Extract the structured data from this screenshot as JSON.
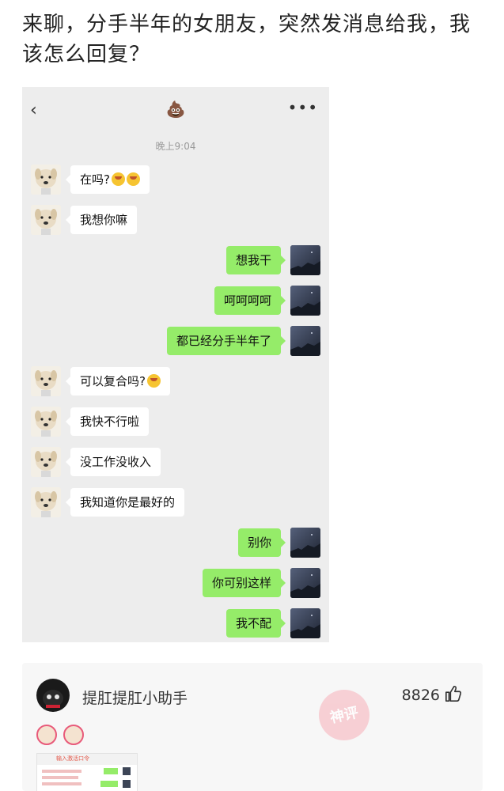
{
  "post": {
    "title": "来聊，分手半年的女朋友，突然发消息给我，我该怎么回复？"
  },
  "chat": {
    "contact_name": "💩",
    "timestamp": "晚上9:04",
    "messages": [
      {
        "side": "left",
        "text": "在吗?",
        "emoji_count": 2
      },
      {
        "side": "left",
        "text": "我想你嘛"
      },
      {
        "side": "right",
        "text": "想我干"
      },
      {
        "side": "right",
        "text": "呵呵呵呵"
      },
      {
        "side": "right",
        "text": "都已经分手半年了"
      },
      {
        "side": "left",
        "text": "可以复合吗?",
        "emoji_count": 1
      },
      {
        "side": "left",
        "text": "我快不行啦"
      },
      {
        "side": "left",
        "text": "没工作没收入"
      },
      {
        "side": "left",
        "text": "我知道你是最好的"
      },
      {
        "side": "right",
        "text": "别你"
      },
      {
        "side": "right",
        "text": "你可别这样"
      },
      {
        "side": "right",
        "text": "我不配"
      }
    ]
  },
  "comment": {
    "username": "提肛提肛小助手",
    "likes": "8826",
    "stamp": "神评",
    "thumbnail_title": "输入激活口令"
  },
  "colors": {
    "chat_bg": "#ededed",
    "self_bubble": "#95ec69",
    "other_bubble": "#ffffff"
  }
}
